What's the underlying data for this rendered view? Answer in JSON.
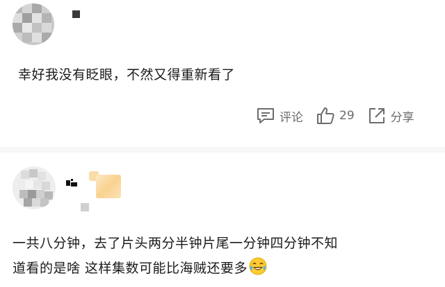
{
  "comments": [
    {
      "text": "幸好我没有眨眼，不然又得重新看了",
      "actions": {
        "comment_label": "评论",
        "like_count": "29",
        "share_label": "分享"
      },
      "icons": [
        "comment-icon",
        "thumbs-up-icon",
        "share-icon"
      ]
    },
    {
      "lines": [
        "一共八分钟，去了片头两分半钟片尾一分钟四分钟不知",
        "道看的是啥 这样集数可能比海贼还要多"
      ],
      "emoji": "laughing-tears-emoji"
    }
  ],
  "colors": {
    "text": "#1a1a1a",
    "muted": "#6b6b6b",
    "divider": "#f7f7f7"
  }
}
